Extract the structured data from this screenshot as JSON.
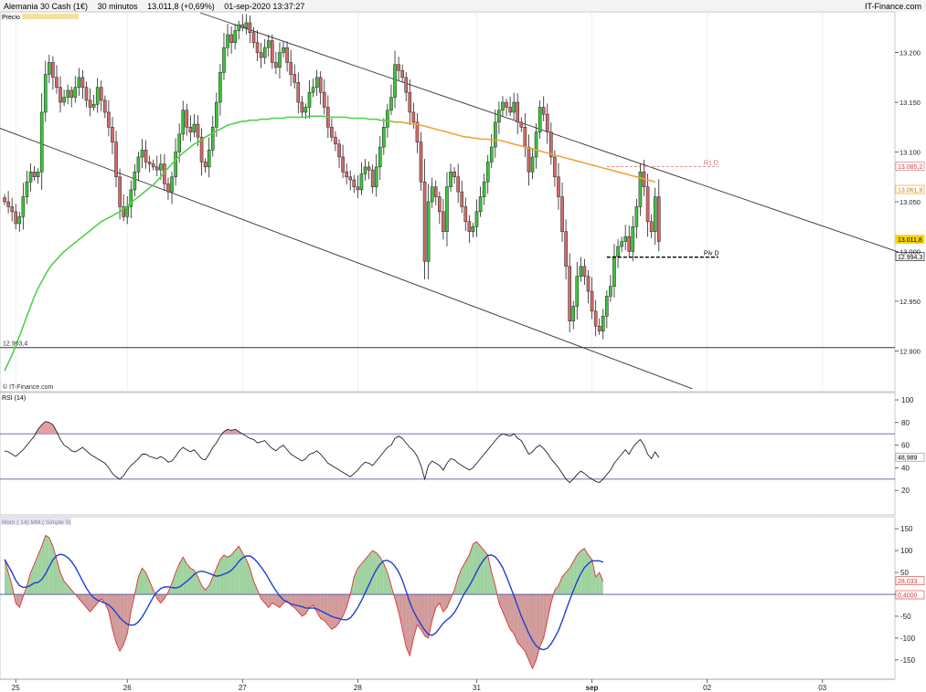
{
  "header": {
    "instrument": "Alemania 30 Cash (1€)",
    "timeframe": "30 minutos",
    "last": "13.011,8 (+0,69%)",
    "datetime": "01-sep-2020 13:37:27",
    "brand": "IT-Finance.com",
    "watermark": "© IT-Finance.com"
  },
  "chart_data": [
    {
      "type": "candlestick",
      "title": "Precio",
      "ylim": [
        12860,
        13240
      ],
      "y_ticks": [
        12900,
        12950,
        13000,
        13050,
        13100,
        13150,
        13200
      ],
      "y_tick_labels": [
        "12.900",
        "12.950",
        "13.000",
        "13.050",
        "13.100",
        "13.150",
        "13.200"
      ],
      "x_ticks": [
        {
          "label": "25",
          "idx": 3
        },
        {
          "label": "26",
          "idx": 33
        },
        {
          "label": "27",
          "idx": 64
        },
        {
          "label": "28",
          "idx": 95
        },
        {
          "label": "31",
          "idx": 127
        },
        {
          "label": "sep",
          "idx": 158
        },
        {
          "label": "02",
          "idx": 189
        },
        {
          "label": "03",
          "idx": 220
        }
      ],
      "bars_total": 240,
      "last_idx": 175,
      "closes": [
        13050,
        13045,
        13040,
        13028,
        13035,
        13055,
        13070,
        13080,
        13075,
        13080,
        13140,
        13178,
        13190,
        13175,
        13165,
        13150,
        13155,
        13162,
        13155,
        13165,
        13175,
        13165,
        13152,
        13145,
        13148,
        13165,
        13152,
        13140,
        13125,
        13110,
        13075,
        13045,
        13035,
        13045,
        13062,
        13080,
        13095,
        13102,
        13090,
        13088,
        13085,
        13082,
        13088,
        13068,
        13060,
        13075,
        13100,
        13118,
        13142,
        13125,
        13120,
        13128,
        13115,
        13090,
        13085,
        13102,
        13125,
        13150,
        13180,
        13205,
        13218,
        13210,
        13222,
        13228,
        13225,
        13230,
        13220,
        13210,
        13200,
        13195,
        13205,
        13212,
        13190,
        13185,
        13200,
        13205,
        13190,
        13178,
        13170,
        13150,
        13140,
        13145,
        13160,
        13165,
        13175,
        13160,
        13145,
        13125,
        13115,
        13108,
        13095,
        13080,
        13075,
        13072,
        13065,
        13062,
        13078,
        13085,
        13082,
        13065,
        13085,
        13105,
        13125,
        13142,
        13155,
        13188,
        13182,
        13175,
        13160,
        13140,
        13130,
        13110,
        13070,
        12990,
        13050,
        13065,
        13055,
        13040,
        13020,
        13065,
        13080,
        13075,
        13060,
        13045,
        13030,
        13020,
        13025,
        13040,
        13055,
        13070,
        13090,
        13105,
        13130,
        13142,
        13150,
        13145,
        13140,
        13150,
        13130,
        13125,
        13105,
        13080,
        13095,
        13120,
        13145,
        13138,
        13120,
        13095,
        13075,
        13055,
        13020,
        12985,
        12930,
        12945,
        12975,
        12985,
        12975,
        12960,
        12940,
        12925,
        12920,
        12935,
        12955,
        12965,
        12995,
        13005,
        13010,
        13015,
        13000,
        13025,
        13045,
        13080,
        13065,
        13030,
        13020,
        13055,
        13010
      ],
      "series": [
        {
          "name": "MA",
          "values": [
            12880,
            12888,
            12896,
            12905,
            12915,
            12925,
            12935,
            12945,
            12955,
            12963,
            12970,
            12977,
            12983,
            12988,
            12992,
            12996,
            13000,
            13003,
            13006,
            13009,
            13012,
            13015,
            13018,
            13021,
            13024,
            13027,
            13030,
            13032,
            13034,
            13036,
            13038,
            13040,
            13043,
            13046,
            13049,
            13052,
            13055,
            13058,
            13061,
            13064,
            13067,
            13071,
            13075,
            13080,
            13084,
            13088,
            13092,
            13096,
            13099,
            13102,
            13105,
            13108,
            13110,
            13112,
            13115,
            13117,
            13119,
            13121,
            13123,
            13125,
            13127,
            13128,
            13129,
            13130,
            13131,
            13131,
            13132,
            13132,
            13132,
            13133,
            13133,
            13133,
            13134,
            13134,
            13134,
            13134,
            13135,
            13135,
            13135,
            13135,
            13135,
            13135,
            13136,
            13136,
            13136,
            13136,
            13136,
            13135,
            13135,
            13135,
            13135,
            13135,
            13135,
            13134,
            13134,
            13134,
            13134,
            13134,
            13133,
            13133,
            13133,
            13132,
            13132,
            13131,
            13131,
            13130,
            13130,
            13130,
            13129,
            13129,
            13128,
            13128,
            13127,
            13126,
            13125,
            13124,
            13123,
            13122,
            13121,
            13120,
            13119,
            13118,
            13117,
            13116,
            13115,
            13115,
            13114,
            13114,
            13113,
            13113,
            13113,
            13112,
            13112,
            13112,
            13111,
            13110,
            13109,
            13108,
            13107,
            13106,
            13105,
            13104,
            13103,
            13102,
            13101,
            13100,
            13099,
            13098,
            13097,
            13096,
            13095,
            13094,
            13093,
            13092,
            13091,
            13090,
            13089,
            13088,
            13087,
            13086,
            13085,
            13084,
            13083,
            13082,
            13081,
            13080,
            13079,
            13078,
            13077,
            13076,
            13075,
            13074,
            13073,
            13072,
            13071,
            13070
          ]
        }
      ],
      "channel_upper": [
        [
          -2,
          13310
        ],
        [
          240,
          13000
        ]
      ],
      "channel_lower": [
        [
          -2,
          13125
        ],
        [
          185,
          12862
        ]
      ],
      "support_line": 12903.4,
      "support_label": "12.903,4",
      "levels": [
        {
          "name": "R1 D",
          "value": 13085.2,
          "label": "13.085,2",
          "from_idx": 162,
          "to_idx": 192,
          "color": "#e06666"
        },
        {
          "name": "Piv D",
          "value": 12994.3,
          "label": "12.994,3",
          "from_idx": 162,
          "to_idx": 192,
          "color": "#000000"
        }
      ],
      "markers": [
        {
          "label": "13.061,9",
          "value": 13061.9,
          "color": "#f5a623"
        },
        {
          "label": "13.011,8",
          "value": 13011.8,
          "color": "#f7d300"
        }
      ]
    },
    {
      "type": "line",
      "title": "RSI (14)",
      "ylim": [
        0,
        100
      ],
      "y_ticks": [
        20,
        40,
        60,
        80,
        100
      ],
      "y_tick_labels": [
        "20",
        "40",
        "60",
        "80",
        "100"
      ],
      "overbought": 70,
      "oversold": 30,
      "last_label": "48,989",
      "values": [
        55,
        54,
        52,
        50,
        53,
        56,
        60,
        64,
        68,
        74,
        78,
        81,
        80,
        78,
        72,
        65,
        60,
        58,
        55,
        54,
        56,
        58,
        55,
        52,
        50,
        48,
        46,
        44,
        40,
        35,
        32,
        30,
        33,
        38,
        42,
        45,
        48,
        52,
        52,
        50,
        49,
        48,
        50,
        48,
        45,
        46,
        50,
        55,
        58,
        56,
        54,
        56,
        52,
        48,
        47,
        52,
        58,
        62,
        68,
        72,
        74,
        73,
        74,
        72,
        70,
        68,
        66,
        65,
        62,
        63,
        64,
        60,
        57,
        55,
        58,
        60,
        56,
        52,
        50,
        48,
        46,
        48,
        52,
        53,
        55,
        52,
        48,
        44,
        42,
        40,
        38,
        36,
        34,
        32,
        35,
        38,
        42,
        45,
        44,
        42,
        46,
        50,
        54,
        58,
        60,
        66,
        68,
        66,
        62,
        58,
        55,
        50,
        42,
        30,
        42,
        46,
        44,
        42,
        38,
        44,
        48,
        47,
        44,
        42,
        40,
        38,
        40,
        44,
        48,
        52,
        56,
        60,
        64,
        68,
        70,
        69,
        68,
        70,
        66,
        64,
        58,
        52,
        54,
        58,
        60,
        57,
        53,
        48,
        44,
        40,
        35,
        30,
        27,
        30,
        34,
        37,
        35,
        32,
        30,
        28,
        27,
        30,
        34,
        38,
        44,
        48,
        52,
        56,
        52,
        58,
        62,
        65,
        60,
        52,
        48,
        54,
        49
      ]
    },
    {
      "type": "area",
      "title": "Mom ( 14) MM ( Simple 9)",
      "ylim": [
        -190,
        165
      ],
      "y_ticks": [
        -150,
        -100,
        -50,
        0,
        50,
        100,
        150
      ],
      "y_tick_labels": [
        "-150",
        "-100",
        "-50",
        "0",
        "50",
        "100",
        "150"
      ],
      "last_label": "28,033",
      "ma_label": "0,4000",
      "values": [
        80,
        50,
        20,
        -20,
        -30,
        -5,
        20,
        50,
        70,
        90,
        110,
        135,
        130,
        110,
        80,
        50,
        30,
        20,
        10,
        0,
        -10,
        -20,
        -30,
        -40,
        -30,
        -20,
        -10,
        -20,
        -40,
        -80,
        -110,
        -130,
        -115,
        -90,
        -40,
        0,
        40,
        60,
        50,
        30,
        10,
        -10,
        -20,
        -10,
        5,
        25,
        50,
        70,
        85,
        70,
        60,
        55,
        40,
        20,
        10,
        20,
        40,
        60,
        80,
        90,
        85,
        90,
        100,
        110,
        95,
        80,
        60,
        30,
        10,
        -10,
        -20,
        -30,
        -20,
        -25,
        -30,
        -20,
        -15,
        -25,
        -30,
        -40,
        -50,
        -45,
        -30,
        -25,
        -40,
        -55,
        -60,
        -70,
        -80,
        -75,
        -65,
        -50,
        -30,
        0,
        40,
        60,
        70,
        80,
        90,
        100,
        95,
        85,
        70,
        50,
        20,
        -10,
        -40,
        -80,
        -120,
        -140,
        -100,
        -70,
        -80,
        -95,
        -100,
        -60,
        -30,
        -20,
        -40,
        -30,
        -10,
        10,
        40,
        60,
        75,
        90,
        115,
        120,
        110,
        100,
        90,
        50,
        20,
        -20,
        -40,
        -60,
        -80,
        -90,
        -110,
        -120,
        -130,
        -150,
        -170,
        -150,
        -120,
        -100,
        -60,
        -20,
        10,
        20,
        40,
        50,
        60,
        75,
        90,
        100,
        105,
        90,
        80,
        40,
        50,
        30
      ]
    }
  ]
}
